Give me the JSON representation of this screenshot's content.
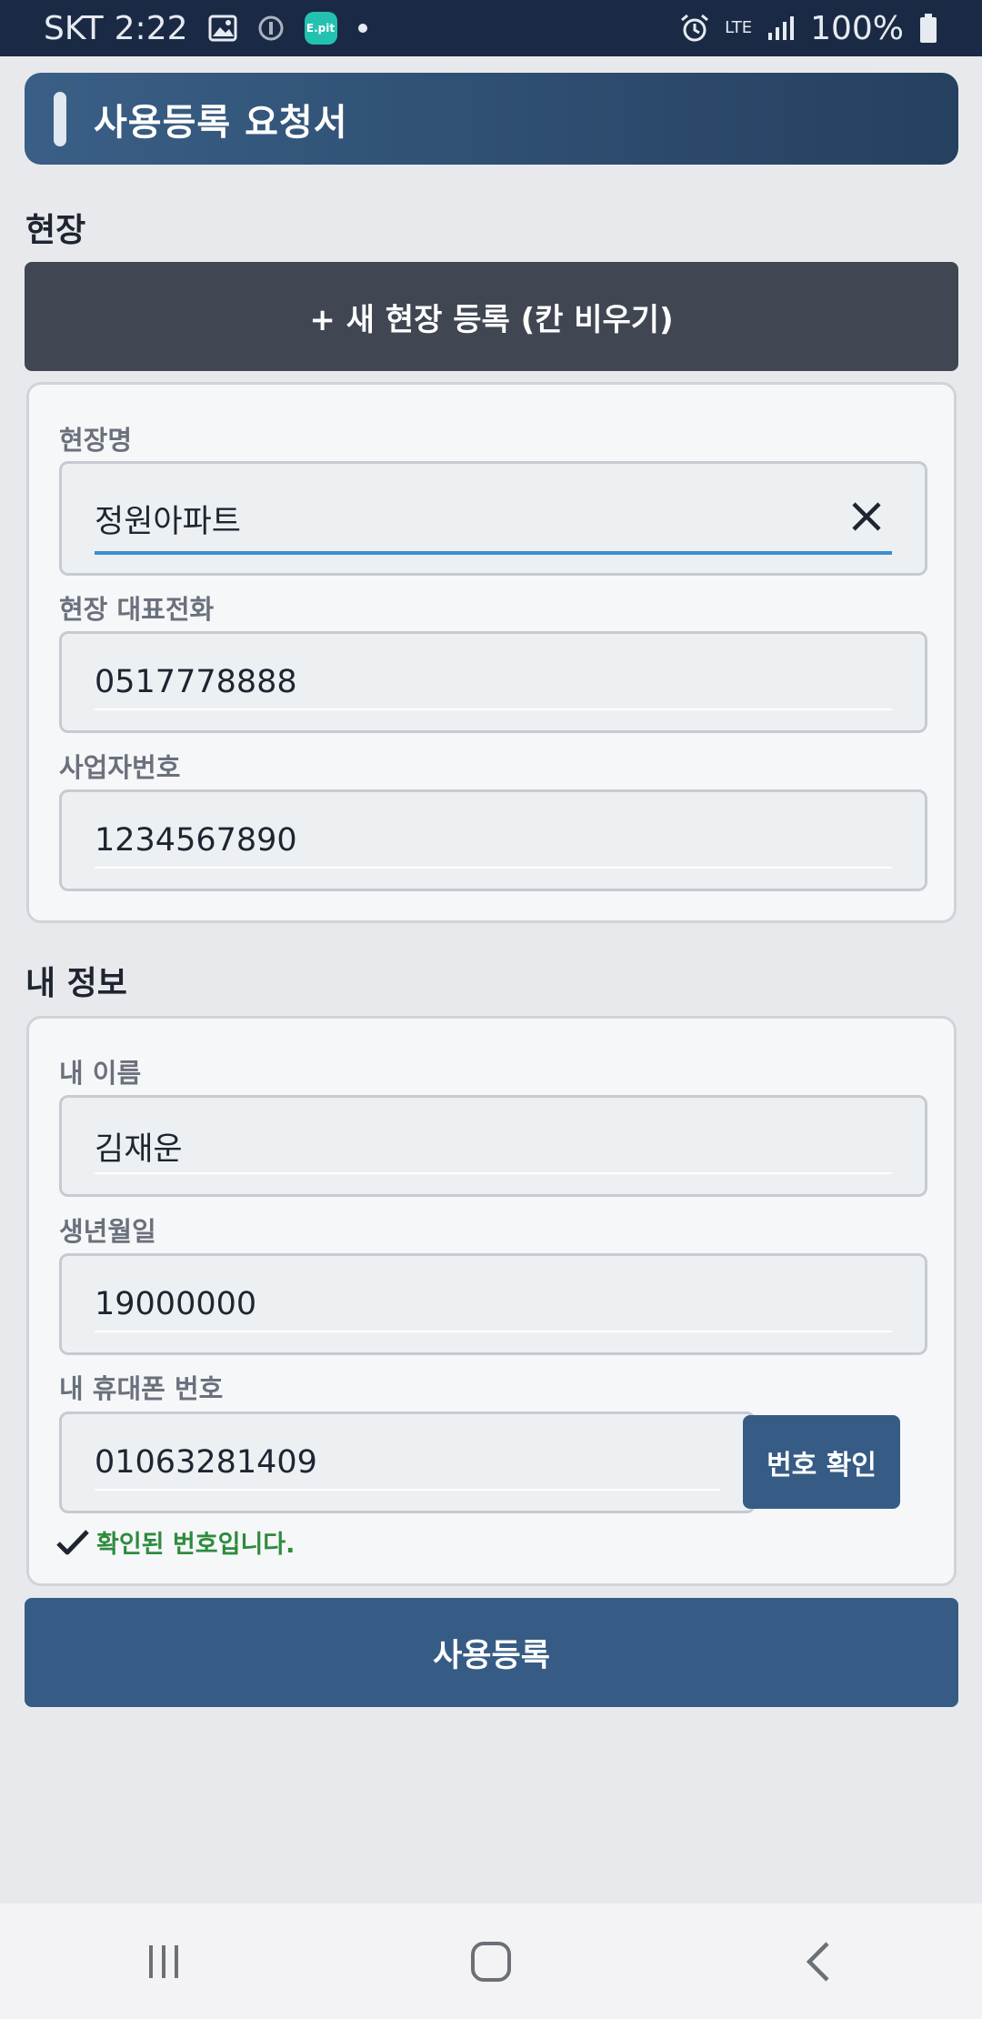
{
  "status_bar": {
    "carrier": "SKT",
    "time": "2:22",
    "epit_label": "E.pit",
    "network": "LTE",
    "battery": "100%"
  },
  "header": {
    "title": "사용등록 요청서"
  },
  "site_section": {
    "heading": "현장",
    "new_site_button": "+ 새 현장 등록 (칸 비우기)",
    "fields": {
      "site_name": {
        "label": "현장명",
        "value": "정원아파트"
      },
      "site_phone": {
        "label": "현장 대표전화",
        "value": "0517778888"
      },
      "business_number": {
        "label": "사업자번호",
        "value": "1234567890"
      }
    }
  },
  "my_info_section": {
    "heading": "내 정보",
    "fields": {
      "name": {
        "label": "내 이름",
        "value": "김재운"
      },
      "birthdate": {
        "label": "생년월일",
        "value": "19000000"
      },
      "phone": {
        "label": "내 휴대폰 번호",
        "value": "01063281409"
      }
    },
    "verify_button": "번호 확인",
    "verify_status": "확인된 번호입니다."
  },
  "submit_button": "사용등록",
  "colors": {
    "primary": "#365c85",
    "dark_button": "#404753",
    "success": "#2e8b3e",
    "focus_line": "#3b8fd0"
  }
}
